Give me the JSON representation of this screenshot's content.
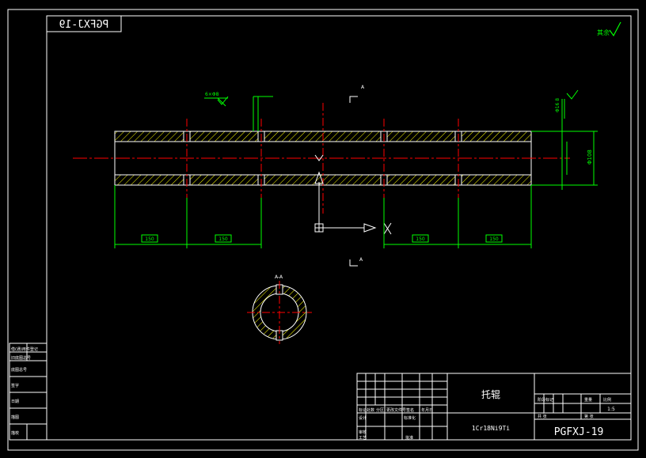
{
  "drawing": {
    "stamp_mirrored": "PGFXJ-19",
    "part_number": "PGFXJ-19",
    "part_name": "托辊",
    "material": "1Cr18Ni9Ti",
    "scale": "1:5",
    "roughness_note": "其余",
    "section_label_top": "A",
    "section_label_bottom": "A",
    "section_view_title": "A-A",
    "dim_outer_diameter": "Φ108",
    "dims_bottom": [
      "150",
      "150",
      "150",
      "150"
    ],
    "dim_chamfer_left": "6×Φ8",
    "dim_right_side": "Φ16 8"
  },
  "title_block": {
    "labels_row_a": [
      "标记",
      "处数",
      "分区",
      "更改文件号",
      "签名",
      "年月日"
    ],
    "labels_row_b": [
      "设计",
      "",
      "标准化",
      "",
      "阶段标记",
      "重量",
      "比例"
    ],
    "labels_row_c": [
      "审核",
      "",
      "",
      "",
      "共 张",
      "第 张"
    ],
    "labels_row_d": [
      "工艺",
      "",
      "批准"
    ]
  },
  "left_block": {
    "rows": [
      "借(通)用件登记",
      "旧底图总号",
      "底图总号",
      "签字",
      "日期",
      "描图",
      "描校"
    ]
  },
  "colors": {
    "background": "#000000",
    "outline": "#ffffff",
    "dimension": "#00ff00",
    "centerline": "#ff0000",
    "hatch": "#ffff00",
    "section_ring": "#ffffff"
  }
}
